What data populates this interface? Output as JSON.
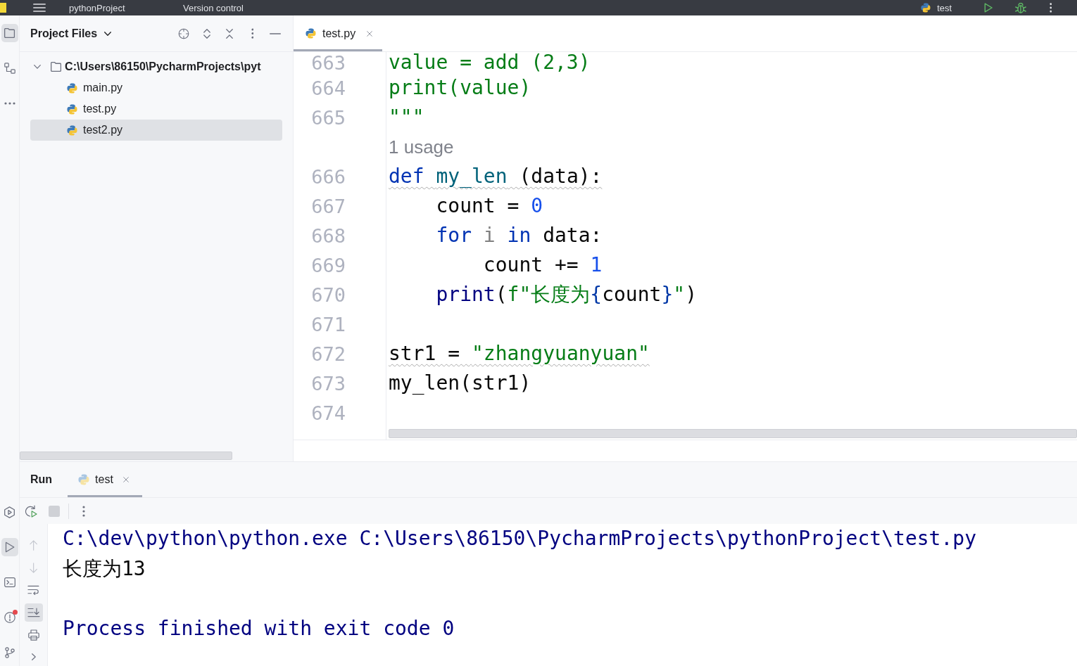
{
  "title_bar": {
    "project": "pythonProject",
    "vcs": "Version control",
    "run_config": "test"
  },
  "tool_strip": {
    "top": [
      {
        "kind": "project",
        "selected": true
      },
      {
        "kind": "structure",
        "selected": false
      },
      {
        "kind": "more",
        "selected": false
      }
    ],
    "bottom": [
      {
        "kind": "services",
        "selected": false,
        "alert": false
      },
      {
        "kind": "run",
        "selected": true,
        "alert": false
      },
      {
        "kind": "terminal",
        "selected": false,
        "alert": false
      },
      {
        "kind": "problems",
        "selected": false,
        "alert": true
      },
      {
        "kind": "git",
        "selected": false,
        "alert": false
      }
    ]
  },
  "project_panel": {
    "title": "Project Files",
    "tree": [
      {
        "label": "C:\\Users\\86150\\PycharmProjects\\pyt",
        "kind": "folder",
        "expanded": true,
        "selected": false,
        "children": [
          {
            "label": "main.py",
            "kind": "python",
            "selected": false
          },
          {
            "label": "test.py",
            "kind": "python",
            "selected": false
          },
          {
            "label": "test2.py",
            "kind": "python",
            "selected": true
          }
        ]
      }
    ]
  },
  "editor": {
    "tabs": [
      {
        "label": "test.py",
        "selected": true
      }
    ],
    "lines": [
      {
        "kind": "code",
        "number": "663",
        "warning": false,
        "tokens": [
          {
            "text": "value = add (2,3)",
            "kind": "string"
          }
        ]
      },
      {
        "kind": "code",
        "number": "664",
        "warning": false,
        "tokens": [
          {
            "text": "print(value)",
            "kind": "string"
          }
        ]
      },
      {
        "kind": "code",
        "number": "665",
        "warning": false,
        "tokens": [
          {
            "text": "\"\"\"",
            "kind": "string"
          }
        ]
      },
      {
        "kind": "inlay",
        "text": "1 usage"
      },
      {
        "kind": "code",
        "number": "666",
        "warning": true,
        "tokens": [
          {
            "text": "def ",
            "kind": "keyword"
          },
          {
            "text": "my_len",
            "kind": "function"
          },
          {
            "text": " (data):",
            "kind": "plain"
          }
        ]
      },
      {
        "kind": "code",
        "number": "667",
        "warning": false,
        "tokens": [
          {
            "text": "    count = ",
            "kind": "plain"
          },
          {
            "text": "0",
            "kind": "number"
          }
        ]
      },
      {
        "kind": "code",
        "number": "668",
        "warning": false,
        "tokens": [
          {
            "text": "    for ",
            "kind": "keyword"
          },
          {
            "text": "i",
            "kind": "unused"
          },
          {
            "text": " in ",
            "kind": "keyword"
          },
          {
            "text": "data:",
            "kind": "plain"
          }
        ]
      },
      {
        "kind": "code",
        "number": "669",
        "warning": false,
        "tokens": [
          {
            "text": "        count += ",
            "kind": "plain"
          },
          {
            "text": "1",
            "kind": "number"
          }
        ]
      },
      {
        "kind": "code",
        "number": "670",
        "warning": false,
        "tokens": [
          {
            "text": "    print",
            "kind": "builtin"
          },
          {
            "text": "(",
            "kind": "plain"
          },
          {
            "text": "f\"长度为",
            "kind": "string"
          },
          {
            "text": "{",
            "kind": "brace"
          },
          {
            "text": "count",
            "kind": "plain"
          },
          {
            "text": "}",
            "kind": "brace"
          },
          {
            "text": "\"",
            "kind": "string"
          },
          {
            "text": ")",
            "kind": "plain"
          }
        ]
      },
      {
        "kind": "code",
        "number": "671"
      },
      {
        "kind": "code",
        "number": "672",
        "warning": true,
        "tokens": [
          {
            "text": "str1 = ",
            "kind": "plain"
          },
          {
            "text": "\"zhangyuanyuan\"",
            "kind": "string"
          }
        ]
      },
      {
        "kind": "code",
        "number": "673",
        "warning": false,
        "tokens": [
          {
            "text": "my_len(str1)",
            "kind": "plain"
          }
        ]
      },
      {
        "kind": "code",
        "number": "674"
      }
    ]
  },
  "run_panel": {
    "title": "Run",
    "tabs": [
      {
        "label": "test",
        "selected": true,
        "running": false
      }
    ],
    "toolbar": [
      {
        "kind": "rerun",
        "disabled": false
      },
      {
        "kind": "stop",
        "disabled": true
      },
      {
        "kind": "more",
        "disabled": false
      }
    ],
    "side_tools": [
      {
        "kind": "up",
        "selected": false
      },
      {
        "kind": "down",
        "selected": false
      },
      {
        "kind": "wrap",
        "selected": false
      },
      {
        "kind": "scroll_end",
        "selected": true
      },
      {
        "kind": "print",
        "selected": false
      },
      {
        "kind": "expand",
        "selected": false
      }
    ],
    "output": [
      {
        "kind": "command",
        "text": "C:\\dev\\python\\python.exe C:\\Users\\86150\\PycharmProjects\\pythonProject\\test.py"
      },
      {
        "kind": "stdout",
        "text": "长度为13"
      },
      {
        "kind": "blank"
      },
      {
        "kind": "system",
        "text": "Process finished with exit code 0"
      }
    ]
  }
}
